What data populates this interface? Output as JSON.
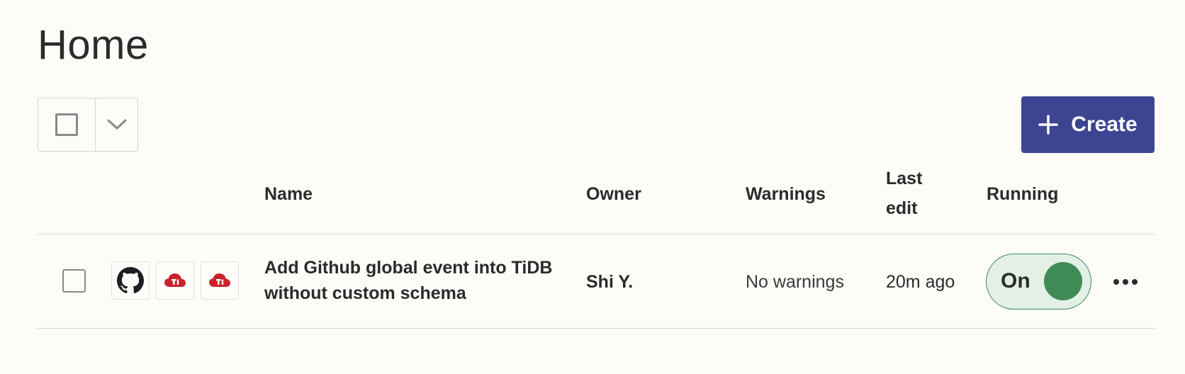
{
  "page": {
    "title": "Home"
  },
  "toolbar": {
    "select_all_icon": "checkbox-icon",
    "select_menu_icon": "chevron-down-icon",
    "create_label": "Create",
    "create_icon": "plus-icon",
    "accent_color": "#3d4592"
  },
  "table": {
    "headers": {
      "name": "Name",
      "owner": "Owner",
      "warnings": "Warnings",
      "last_edit_line1": "Last",
      "last_edit_line2": "edit",
      "running": "Running"
    },
    "rows": [
      {
        "apps": [
          "github-icon",
          "tidb-cloud-icon",
          "tidb-cloud-icon"
        ],
        "name": "Add Github global event into TiDB without custom schema",
        "owner": "Shi Y.",
        "warnings": "No warnings",
        "last_edit": "20m ago",
        "running_label": "On",
        "running_color": "#3e8b56",
        "more_icon": "more-horizontal-icon"
      }
    ]
  }
}
